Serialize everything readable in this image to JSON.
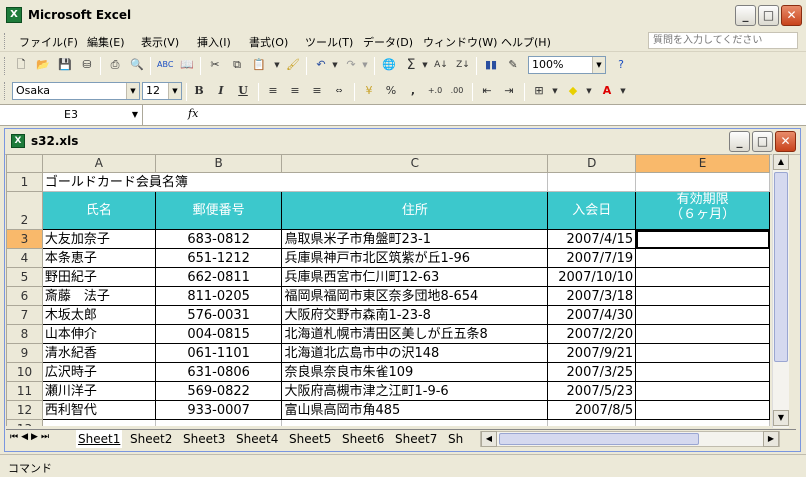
{
  "app": {
    "title": "Microsoft Excel"
  },
  "menu": {
    "items": [
      "ファイル(F)",
      "編集(E)",
      "表示(V)",
      "挿入(I)",
      "書式(O)",
      "ツール(T)",
      "データ(D)",
      "ウィンドウ(W)",
      "ヘルプ(H)"
    ],
    "ask_placeholder": "質問を入力してください"
  },
  "toolbar": {
    "zoom": "100%",
    "font": "Osaka",
    "size": "12",
    "bold": "B",
    "italic": "I",
    "underline": "U",
    "percent": "%",
    "comma": ","
  },
  "formula": {
    "namebox": "E3",
    "fx": "fx",
    "value": ""
  },
  "workbook": {
    "title": "s32.xls"
  },
  "sheet": {
    "columns": [
      "A",
      "B",
      "C",
      "D",
      "E"
    ],
    "selected_column": "E",
    "selected_row": "3",
    "title_row": {
      "row": "1",
      "text": "ゴールドカード会員名簿"
    },
    "header_row": {
      "row": "2",
      "cells": [
        "氏名",
        "郵便番号",
        "住所",
        "入会日"
      ],
      "e_line1": "有効期限",
      "e_line2": "（６ヶ月）"
    },
    "rows": [
      {
        "n": "3",
        "name": "大友加奈子",
        "zip": "683-0812",
        "addr": "鳥取県米子市角盤町23-1",
        "date": "2007/4/15",
        "exp": ""
      },
      {
        "n": "4",
        "name": "本条恵子",
        "zip": "651-1212",
        "addr": "兵庫県神戸市北区筑紫が丘1-96",
        "date": "2007/7/19",
        "exp": ""
      },
      {
        "n": "5",
        "name": "野田紀子",
        "zip": "662-0811",
        "addr": "兵庫県西宮市仁川町12-63",
        "date": "2007/10/10",
        "exp": ""
      },
      {
        "n": "6",
        "name": "斎藤　法子",
        "zip": "811-0205",
        "addr": "福岡県福岡市東区奈多団地8-654",
        "date": "2007/3/18",
        "exp": ""
      },
      {
        "n": "7",
        "name": "木坂太郎",
        "zip": "576-0031",
        "addr": "大阪府交野市森南1-23-8",
        "date": "2007/4/30",
        "exp": ""
      },
      {
        "n": "8",
        "name": "山本伸介",
        "zip": "004-0815",
        "addr": "北海道札幌市清田区美しが丘五条8",
        "date": "2007/2/20",
        "exp": ""
      },
      {
        "n": "9",
        "name": "清水紀香",
        "zip": "061-1101",
        "addr": "北海道北広島市中の沢148",
        "date": "2007/9/21",
        "exp": ""
      },
      {
        "n": "10",
        "name": "広沢時子",
        "zip": "631-0806",
        "addr": "奈良県奈良市朱雀109",
        "date": "2007/3/25",
        "exp": ""
      },
      {
        "n": "11",
        "name": "瀬川洋子",
        "zip": "569-0822",
        "addr": "大阪府高槻市津之江町1-9-6",
        "date": "2007/5/23",
        "exp": ""
      },
      {
        "n": "12",
        "name": "西利智代",
        "zip": "933-0007",
        "addr": "富山県高岡市角485",
        "date": "2007/8/5",
        "exp": ""
      }
    ],
    "partial_row": "13"
  },
  "tabs": [
    "Sheet1",
    "Sheet2",
    "Sheet3",
    "Sheet4",
    "Sheet5",
    "Sheet6",
    "Sheet7",
    "Sh"
  ],
  "status": {
    "text": "コマンド"
  },
  "colors": {
    "header_fill": "#3cc8cc",
    "selected_header": "#f9b96b"
  }
}
